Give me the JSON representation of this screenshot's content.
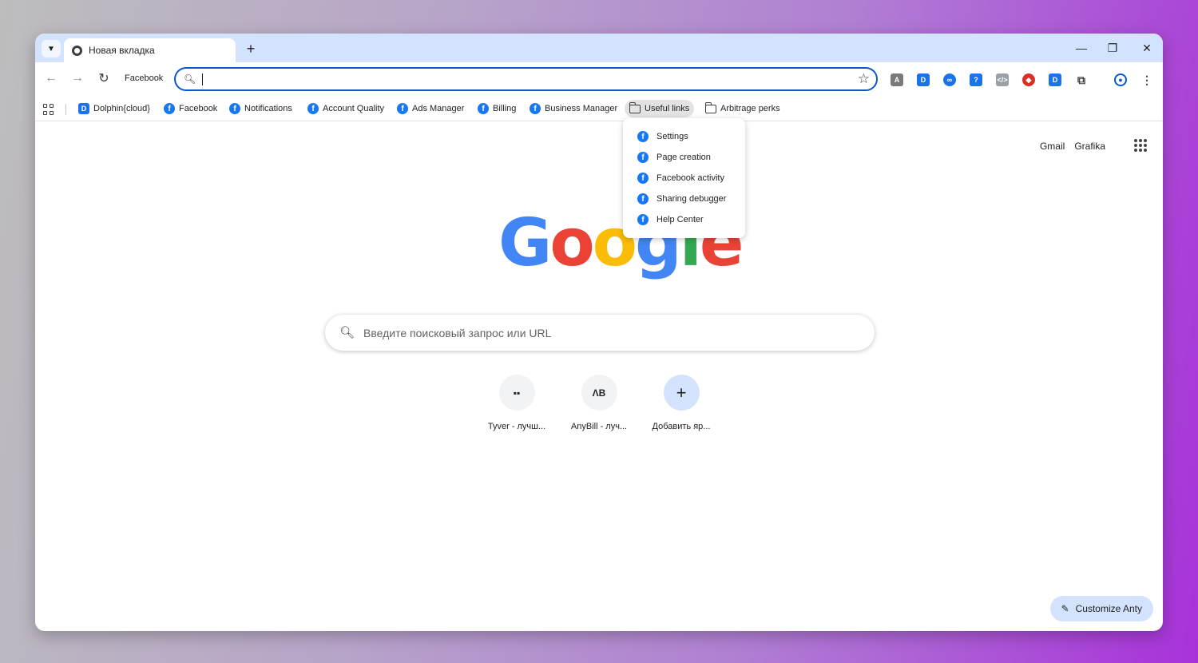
{
  "tab": {
    "title": "Новая вкладка"
  },
  "toolbar": {
    "home_label": "Facebook",
    "omnibox_value": ""
  },
  "bookmarks": [
    {
      "label": "Dolphin{cloud}",
      "icon": "dolphin-icon"
    },
    {
      "label": "Facebook",
      "icon": "facebook-icon"
    },
    {
      "label": "Notifications",
      "icon": "facebook-icon"
    },
    {
      "label": "Account Quality",
      "icon": "facebook-icon"
    },
    {
      "label": "Ads Manager",
      "icon": "facebook-icon"
    },
    {
      "label": "Billing",
      "icon": "facebook-icon"
    },
    {
      "label": "Business Manager",
      "icon": "facebook-icon"
    },
    {
      "label": "Useful links",
      "icon": "folder-icon"
    },
    {
      "label": "Arbitrage perks",
      "icon": "folder-icon"
    }
  ],
  "dropdown": {
    "items": [
      {
        "label": "Settings"
      },
      {
        "label": "Page creation"
      },
      {
        "label": "Facebook activity"
      },
      {
        "label": "Sharing debugger"
      },
      {
        "label": "Help Center"
      }
    ]
  },
  "top_links": {
    "gmail": "Gmail",
    "images": "Grafika"
  },
  "search": {
    "placeholder": "Введите поисковый запрос или URL"
  },
  "shortcuts": [
    {
      "label": "Tyver - лучш...",
      "glyph": "▪▪"
    },
    {
      "label": "AnyBill - луч...",
      "glyph": "ΛB"
    },
    {
      "label": "Добавить яр...",
      "glyph": "+"
    }
  ],
  "customize": {
    "label": "Customize Anty"
  },
  "colors": {
    "accent": "#0b57d0",
    "tabstrip": "#d3e3fd",
    "facebook": "#1877f2"
  }
}
